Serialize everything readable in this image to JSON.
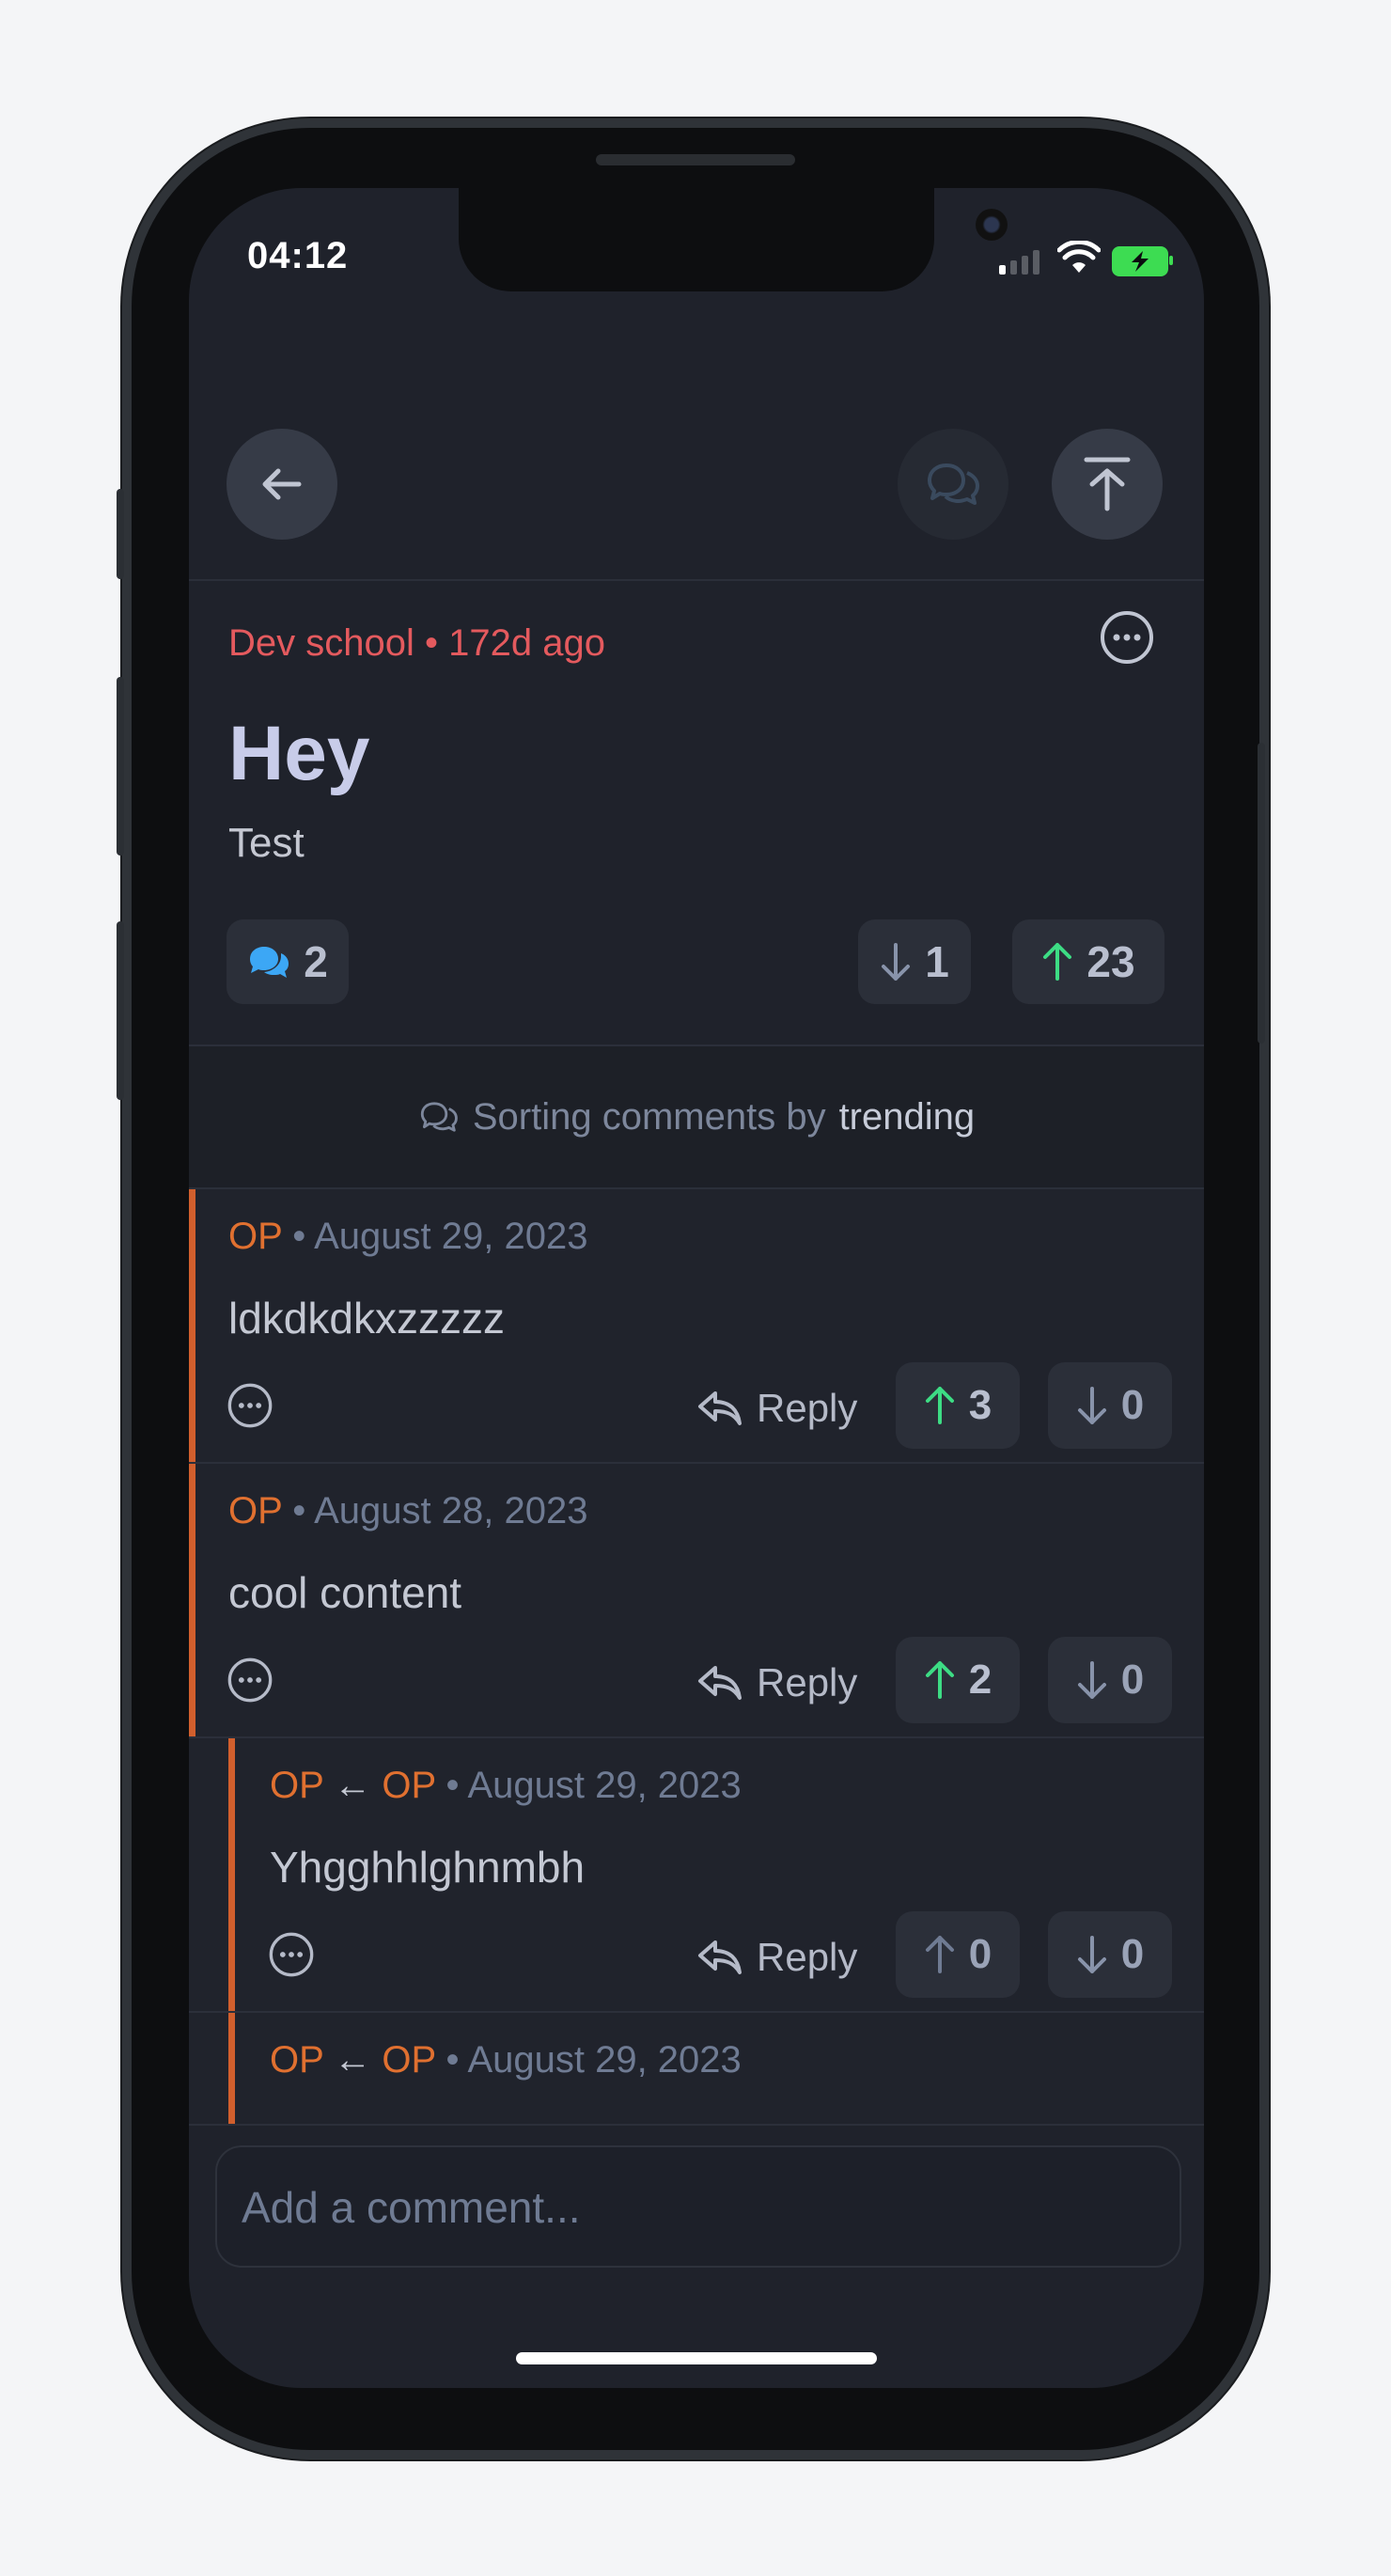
{
  "status": {
    "time": "04:12"
  },
  "post": {
    "community": "Dev school",
    "age": "172d ago",
    "title": "Hey",
    "body": "Test",
    "comment_count": "2",
    "downvotes": "1",
    "upvotes": "23"
  },
  "sort": {
    "prefix": "Sorting comments by",
    "mode": "trending"
  },
  "comments": [
    {
      "author": "OP",
      "reply_to": "",
      "date": "August 29, 2023",
      "text": "ldkdkdkxzzzzz",
      "reply_label": "Reply",
      "up": "3",
      "down": "0"
    },
    {
      "author": "OP",
      "reply_to": "",
      "date": "August 28, 2023",
      "text": "cool content",
      "reply_label": "Reply",
      "up": "2",
      "down": "0"
    },
    {
      "author": "OP",
      "reply_to": "OP",
      "date": "August 29, 2023",
      "text": "Yhgghhlghnmbh",
      "reply_label": "Reply",
      "up": "0",
      "down": "0"
    },
    {
      "author": "OP",
      "reply_to": "OP",
      "date": "August 29, 2023"
    }
  ],
  "composer": {
    "placeholder": "Add a comment..."
  },
  "colors": {
    "accent_red": "#e45a5e",
    "op_orange": "#e07030",
    "upvote_green": "#3ddc84",
    "comment_blue": "#3ca7f5"
  },
  "icons": [
    "back-arrow-icon",
    "chat-bubbles-icon",
    "scroll-to-top-icon",
    "more-dots-icon",
    "reply-icon",
    "upvote-arrow-icon",
    "downvote-arrow-icon"
  ]
}
